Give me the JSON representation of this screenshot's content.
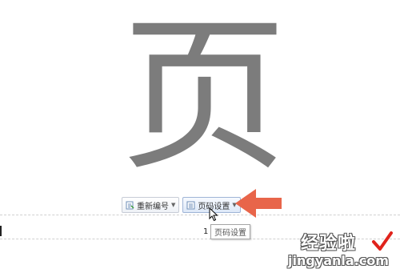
{
  "document": {
    "large_character": "页",
    "page_number": "1"
  },
  "page_number_toolbar": {
    "renumber_label": "重新编号",
    "page_number_settings_label": "页码设置"
  },
  "tooltip": {
    "text": "页码设置"
  },
  "watermark": {
    "brand": "经验啦",
    "url": "jingyanla.com"
  },
  "colors": {
    "large_character": "#7c7c7c",
    "arrow": "#e8654a",
    "watermark_check": "#e0231c",
    "toolbar_border": "#c7ccd6"
  },
  "icons": {
    "renumber": "renumber-icon",
    "settings": "page-settings-icon",
    "pointer": "mouse-pointer-icon",
    "annotation": "red-arrow-icon"
  }
}
